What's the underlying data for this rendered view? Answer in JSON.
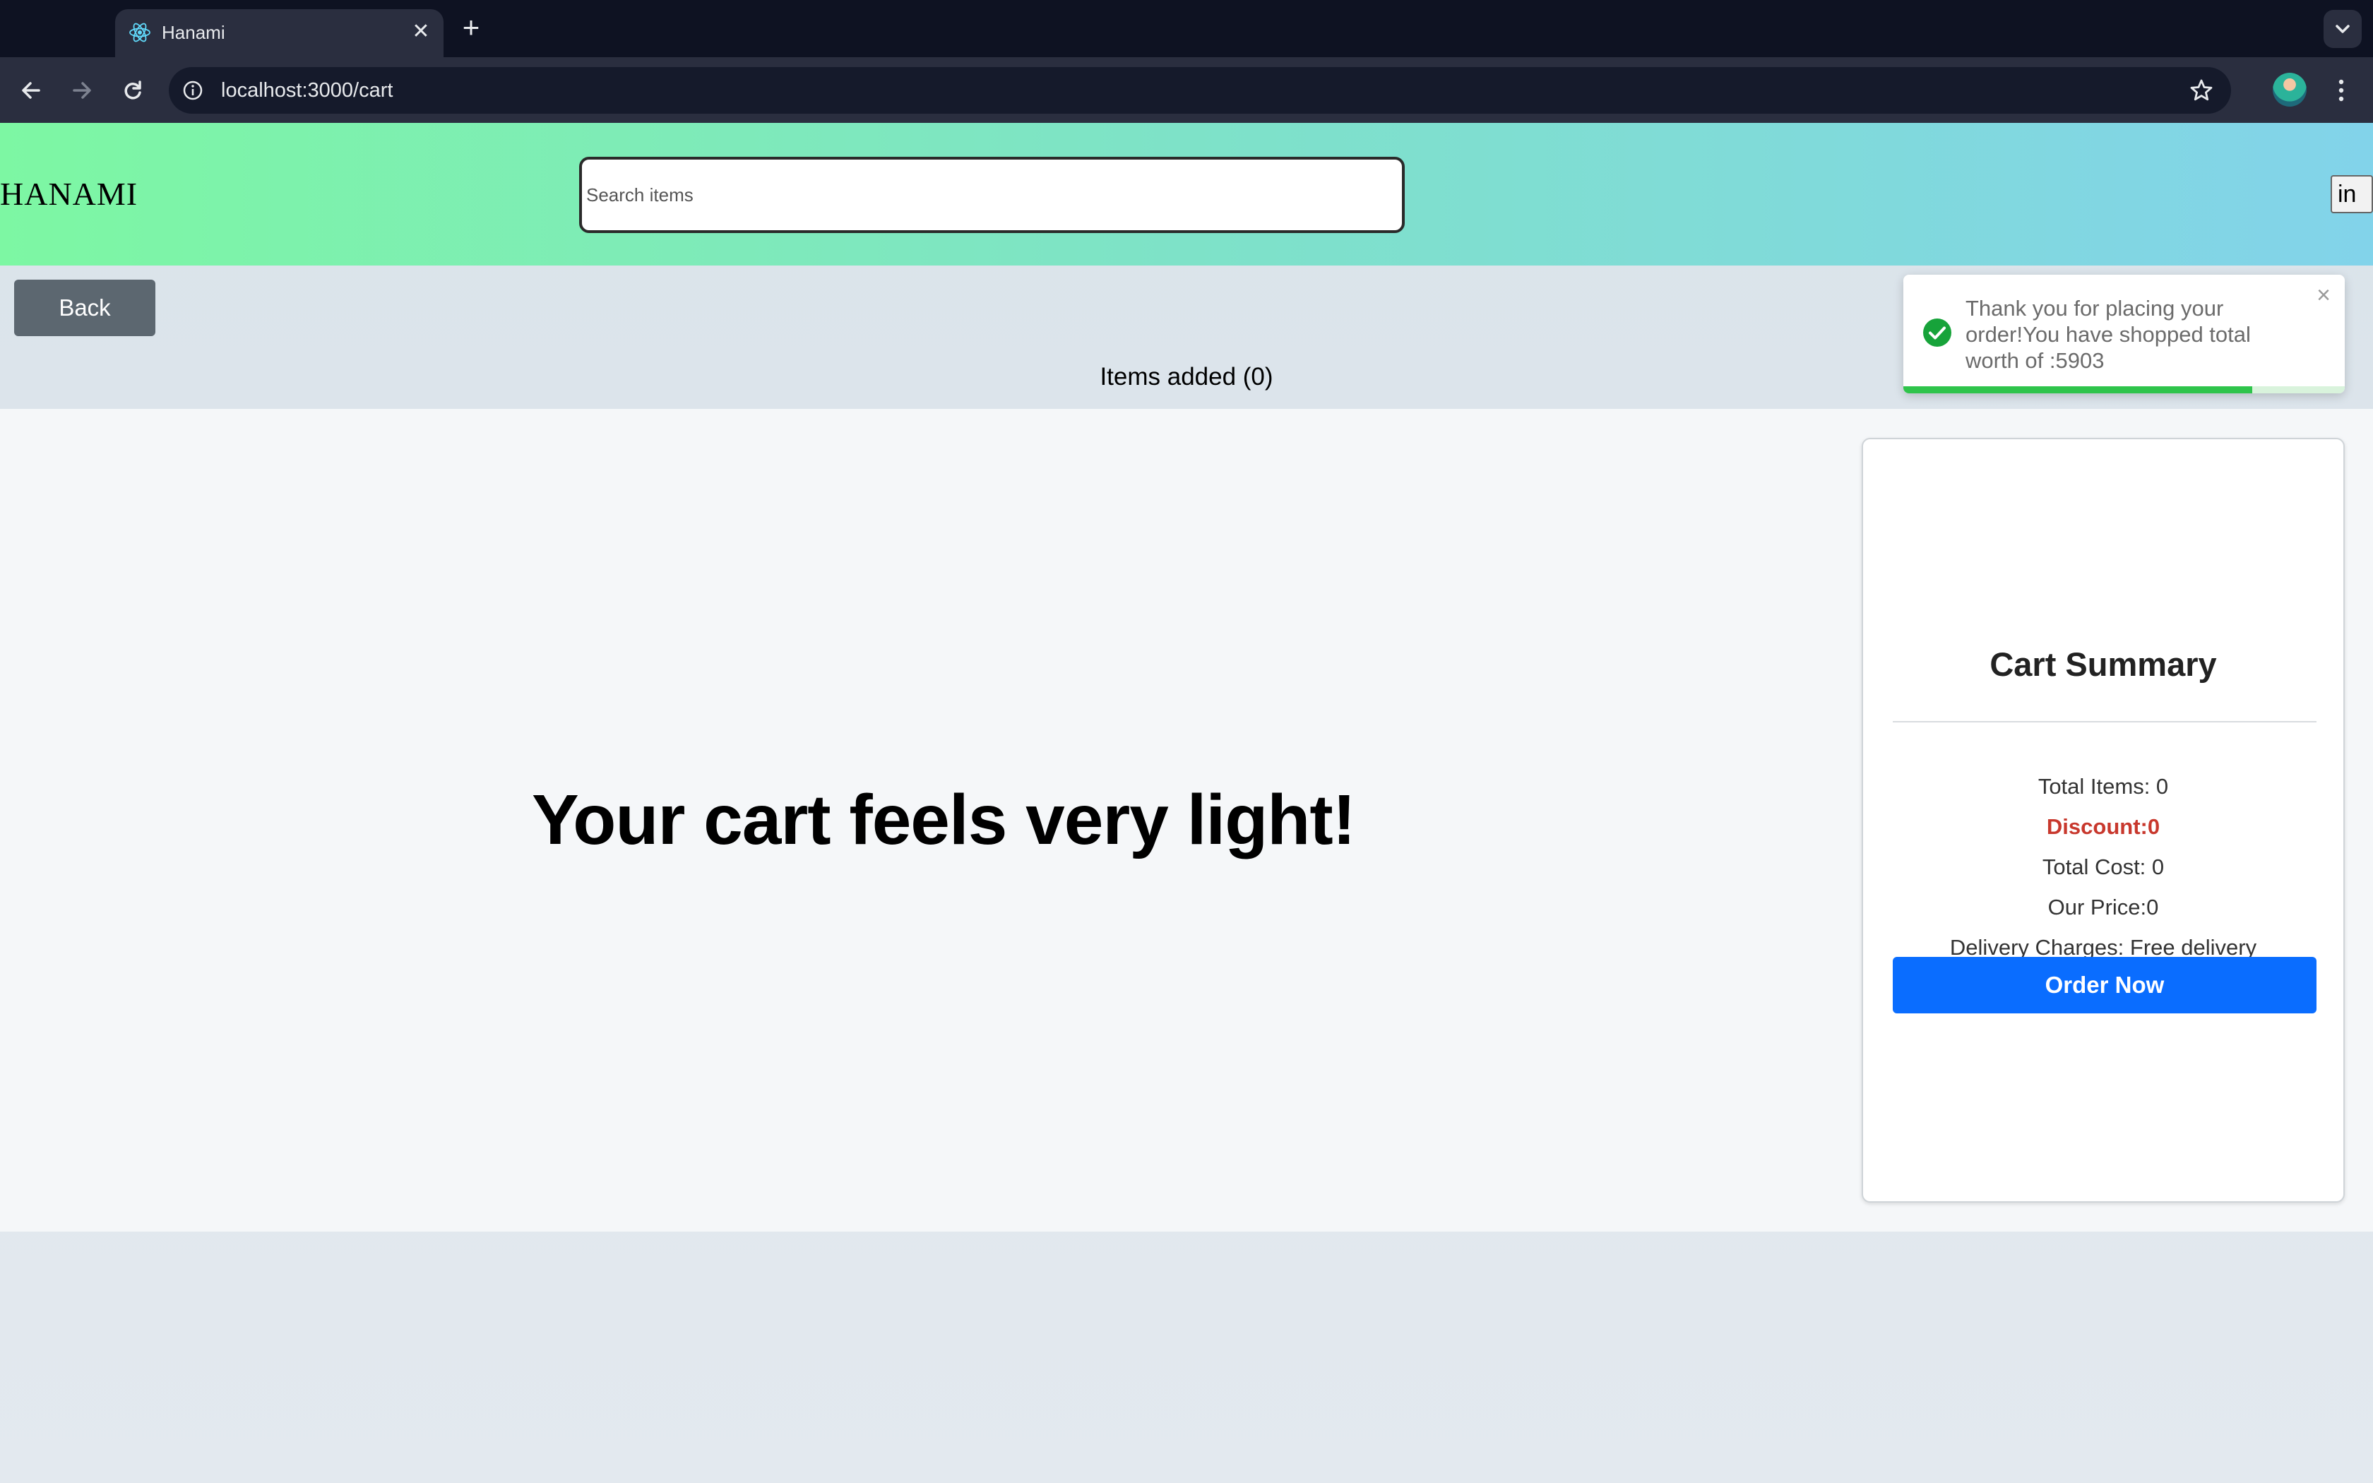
{
  "browser": {
    "tab": {
      "title": "Hanami",
      "favicon": "react-icon"
    },
    "address": {
      "url": "localhost:3000/cart"
    }
  },
  "header": {
    "logo": "HANAMI",
    "search_placeholder": "Search items",
    "search_value": "",
    "login_fragment": "in"
  },
  "nav": {
    "back_label": "Back"
  },
  "cart": {
    "items_added": "Items added (0)",
    "empty_message": "Your cart feels very light!"
  },
  "summary": {
    "title": "Cart Summary",
    "total_items": "Total Items: 0",
    "discount": "Discount:0",
    "total_cost": "Total Cost: 0",
    "our_price": "Our Price:0",
    "delivery": "Delivery Charges: Free delivery",
    "order_label": "Order Now"
  },
  "toast": {
    "message": "Thank you for placing your order!You have shopped total worth of :5903",
    "progress_fraction": 0.79
  },
  "colors": {
    "accent": "#0a6dff",
    "discount": "#c8382d",
    "success": "#2fc44b",
    "header_gradient": [
      "#7df7a3",
      "#82d3ea"
    ]
  }
}
